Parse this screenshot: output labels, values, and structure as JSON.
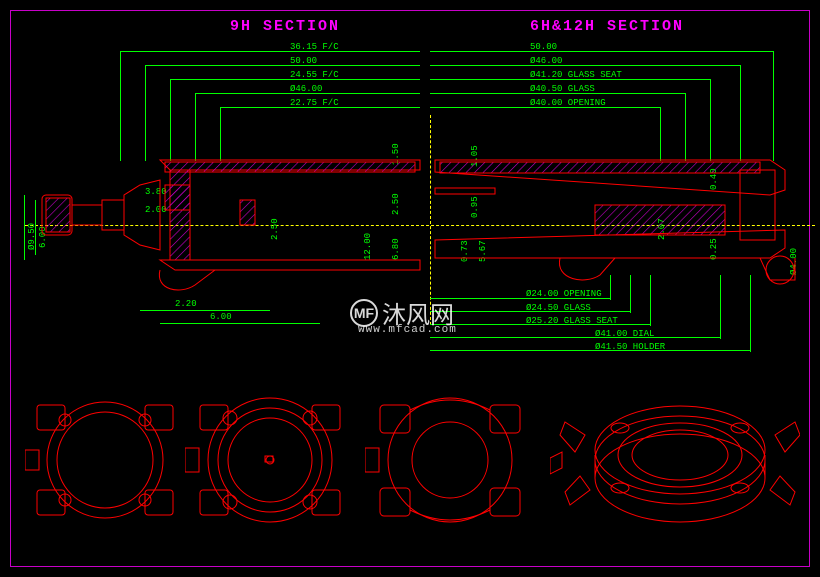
{
  "titles": {
    "left": "9H SECTION",
    "right": "6H&12H SECTION"
  },
  "dims_top_left": [
    "36.15 F/C",
    "50.00",
    "24.55 F/C",
    "Ø46.00",
    "22.75 F/C"
  ],
  "dims_top_right": [
    "50.00",
    "Ø46.00",
    "Ø41.20 GLASS SEAT",
    "Ø40.50 GLASS",
    "Ø40.00 OPENING"
  ],
  "dims_mid_left": [
    "3.80",
    "2.00",
    "2.20",
    "6.00",
    "2.50"
  ],
  "dims_center_v": [
    "1.50",
    "2.50",
    "12.00",
    "6.80"
  ],
  "dims_center_v2": [
    "1.05",
    "0.95",
    "0.73",
    "5.67"
  ],
  "dims_right_mid": [
    "0.40",
    "2.07",
    "0.25"
  ],
  "dims_far_left": [
    "Ø9.50",
    "6.00"
  ],
  "dims_far_right": [
    "Ø4.00"
  ],
  "dims_bottom_right": [
    "Ø24.00 OPENING",
    "Ø24.50 GLASS",
    "Ø25.20 GLASS SEAT",
    "Ø41.00 DIAL",
    "Ø41.50 HOLDER"
  ],
  "watermark": {
    "icon": "MF",
    "text": "沐风网",
    "sub": "www.mfcad.com"
  },
  "colors": {
    "body_line": "#ff0000",
    "dim": "#00ff00",
    "hatch": "#c800c8",
    "center": "#ffff00"
  }
}
